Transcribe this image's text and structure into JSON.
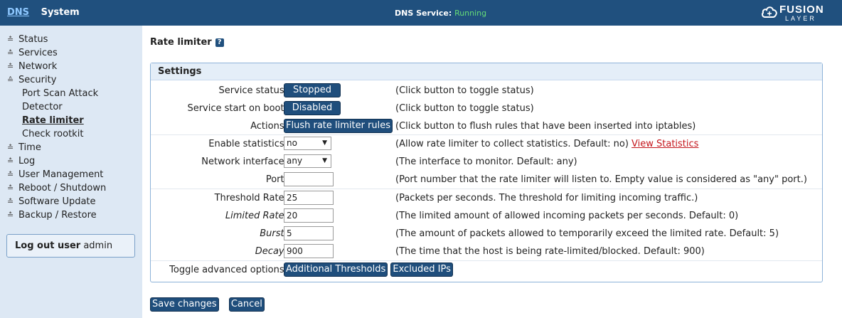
{
  "topbar": {
    "nav_dns": "DNS",
    "nav_system": "System",
    "service_label": "DNS Service:",
    "service_status": "Running",
    "logo_line1": "FUSION",
    "logo_line2": "LAYER"
  },
  "sidebar": {
    "items": [
      {
        "label": "Status",
        "icon": "chevron-down-icon"
      },
      {
        "label": "Services",
        "icon": "chevron-down-icon"
      },
      {
        "label": "Network",
        "icon": "chevron-down-icon"
      },
      {
        "label": "Security",
        "icon": "chevron-up-icon"
      },
      {
        "label": "Time",
        "icon": "chevron-down-icon"
      },
      {
        "label": "Log",
        "icon": "chevron-down-icon"
      },
      {
        "label": "User Management",
        "icon": "chevron-down-icon"
      },
      {
        "label": "Reboot / Shutdown",
        "icon": "chevron-down-icon"
      },
      {
        "label": "Software Update",
        "icon": "chevron-down-icon"
      },
      {
        "label": "Backup / Restore",
        "icon": "chevron-down-icon"
      }
    ],
    "security_sub": [
      {
        "label": "Port Scan Attack"
      },
      {
        "label": "Detector"
      },
      {
        "label": "Rate limiter"
      },
      {
        "label": "Check rootkit"
      }
    ],
    "logout_bold": "Log out user",
    "logout_user": "admin"
  },
  "main": {
    "title": "Rate limiter",
    "help_icon": "?",
    "settings_title": "Settings",
    "rows": {
      "service_status": {
        "label": "Service status:",
        "button": "Stopped",
        "desc": "(Click button to toggle status)"
      },
      "service_boot": {
        "label": "Service start on boot:",
        "button": "Disabled",
        "desc": "(Click button to toggle status)"
      },
      "actions": {
        "label": "Actions:",
        "button": "Flush rate limiter rules",
        "desc": "(Click button to flush rules that have been inserted into iptables)"
      },
      "enable_stats": {
        "label": "Enable statistics:",
        "value": "no",
        "desc": "(Allow rate limiter to collect statistics. Default: no)",
        "link": "View Statistics"
      },
      "network_interface": {
        "label": "Network interface:",
        "value": "any",
        "desc": "(The interface to monitor. Default: any)"
      },
      "port": {
        "label": "Port:",
        "value": "",
        "desc": "(Port number that the rate limiter will listen to. Empty value is considered as \"any\" port.)"
      },
      "threshold_rate": {
        "label": "Threshold Rate:",
        "value": "25",
        "desc": "(Packets per seconds. The threshold for limiting incoming traffic.)"
      },
      "limited_rate": {
        "label": "Limited Rate:",
        "value": "20",
        "desc": "(The limited amount of allowed incoming packets per seconds. Default: 0)"
      },
      "burst": {
        "label": "Burst:",
        "value": "5",
        "desc": "(The amount of packets allowed to temporarily exceed the limited rate. Default: 5)"
      },
      "decay": {
        "label": "Decay:",
        "value": "900",
        "desc": "(The time that the host is being rate-limited/blocked. Default: 900)"
      },
      "advanced": {
        "label": "Toggle advanced options:",
        "button1": "Additional Thresholds",
        "button2": "Excluded IPs"
      }
    },
    "save_label": "Save changes",
    "cancel_label": "Cancel"
  },
  "colors": {
    "topbar": "#20507e",
    "sidebar": "#dde8f4",
    "button": "#1f4e7c",
    "running": "#66dd77",
    "link": "#c4161c"
  }
}
